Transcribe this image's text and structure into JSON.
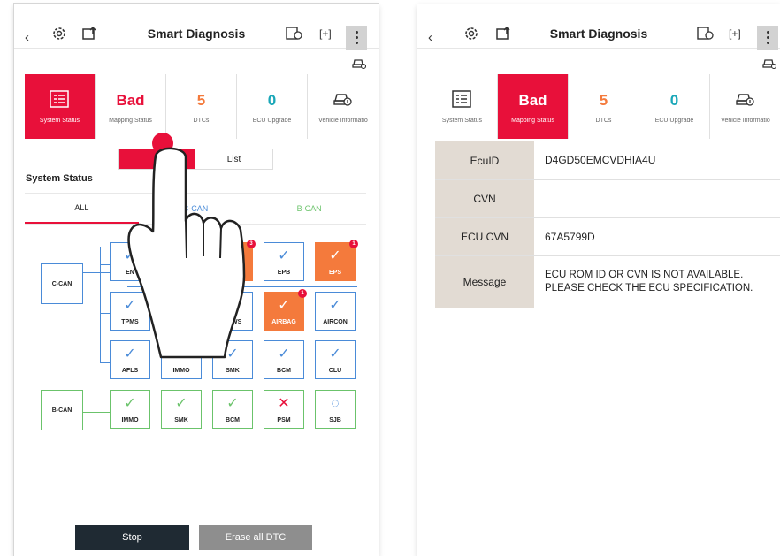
{
  "header": {
    "title": "Smart Diagnosis"
  },
  "tiles": [
    {
      "value": "",
      "label": "System Status"
    },
    {
      "value": "Bad",
      "label": "Mapping Status"
    },
    {
      "value": "5",
      "label": "DTCs"
    },
    {
      "value": "0",
      "label": "ECU Upgrade"
    },
    {
      "value": "",
      "label": "Vehicle Informatio"
    }
  ],
  "view_toggle": {
    "icon_label": "Ic",
    "list_label": "List"
  },
  "section_title": "System Status",
  "subtabs": [
    "ALL",
    "C-CAN",
    "B-CAN"
  ],
  "buses": {
    "ccan": "C-CAN",
    "bcan": "B-CAN"
  },
  "ecus": {
    "ccan_row1": [
      "EN",
      "",
      "",
      "EPB",
      "EPS"
    ],
    "ccan_row2": [
      "TPMS",
      "",
      "LDWS",
      "AIRBAG",
      "AIRCON"
    ],
    "ccan_row3": [
      "AFLS",
      "IMMO",
      "SMK",
      "BCM",
      "CLU"
    ],
    "bcan_row": [
      "IMMO",
      "SMK",
      "BCM",
      "PSM",
      "SJB"
    ],
    "badges": {
      "r1c3": "3",
      "eps": "1",
      "airbag": "1"
    }
  },
  "buttons": {
    "stop": "Stop",
    "erase": "Erase all DTC"
  },
  "ecu_info": [
    {
      "key": "EcuID",
      "value": "D4GD50EMCVDHIA4U"
    },
    {
      "key": "CVN",
      "value": ""
    },
    {
      "key": "ECU CVN",
      "value": "67A5799D"
    },
    {
      "key": "Message",
      "value": "ECU ROM ID OR CVN IS NOT AVAILABLE.\nPLEASE CHECK THE ECU SPECIFICATION."
    }
  ],
  "colors": {
    "accent": "#e8103a",
    "ccan": "#4a8bd8",
    "bcan": "#6bc36b",
    "error": "#f47a3c",
    "table_key_bg": "#e2dbd3"
  }
}
